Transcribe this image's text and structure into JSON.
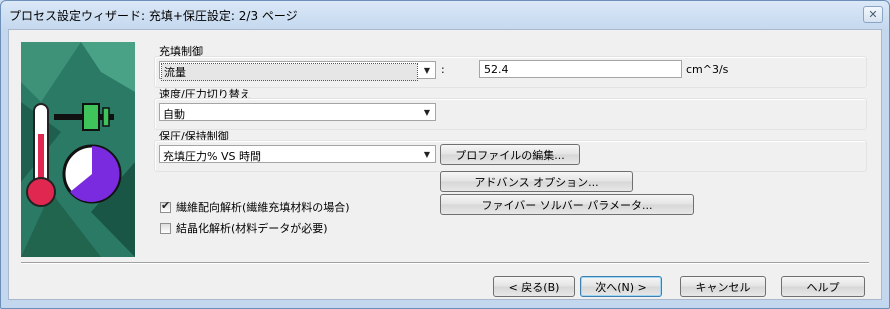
{
  "window": {
    "title": "プロセス設定ウィザード: 充填+保圧設定: 2/3 ページ"
  },
  "fill_control": {
    "label": "充填制御",
    "selected": "流量",
    "separator": ":",
    "value": "52.4",
    "unit": "cm^3/s"
  },
  "velocity_pressure_switch": {
    "label": "速度/圧力切り替え",
    "selected": "自動"
  },
  "pack_holding_control": {
    "label": "保圧/保持制御",
    "selected": "充填圧力% VS 時間",
    "edit_profile_button": "プロファイルの編集..."
  },
  "advanced_options_button": "アドバンス オプション...",
  "fiber_solver_button": "ファイバー ソルバー パラメータ...",
  "fiber_orientation": {
    "label": "繊維配向解析(繊維充填材料の場合)",
    "checked": true
  },
  "crystallization": {
    "label": "結晶化解析(材料データが必要)",
    "checked": false
  },
  "footer": {
    "back": "< 戻る(B)",
    "next": "次へ(N) >",
    "cancel": "キャンセル",
    "help": "ヘルプ"
  },
  "icons": {
    "close": "close-icon",
    "thermometer": "thermometer-icon",
    "clock": "clock-icon",
    "slider": "slider-icon"
  }
}
